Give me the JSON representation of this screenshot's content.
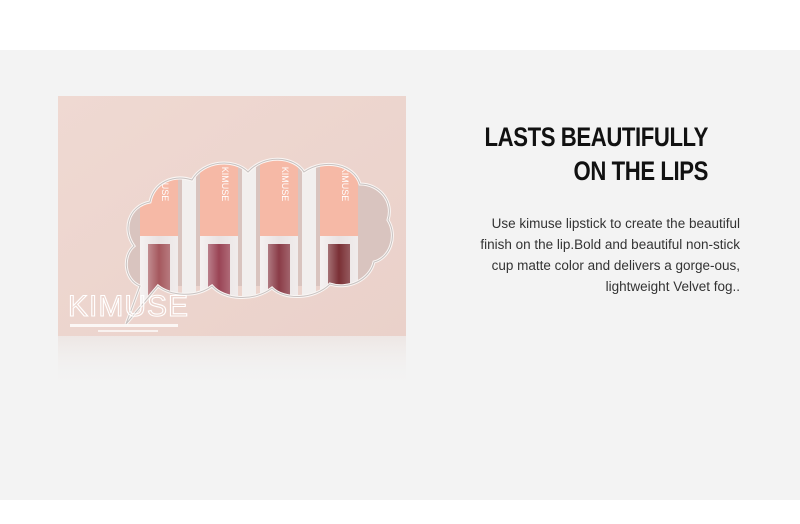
{
  "product": {
    "brand_logo": "KIMUSE",
    "tube_label": "KIMUSE",
    "colors": {
      "box": "#efd9d2",
      "cap": "#f6b9a6",
      "window_border": "#f8f4f2",
      "lipstick_shades": [
        "#a5585e",
        "#9a4455",
        "#8a3c47",
        "#7a3035"
      ]
    }
  },
  "headline": {
    "line1": "LASTS BEAUTIFULLY",
    "line2": "ON THE LIPS"
  },
  "description": {
    "line1": "Use kimuse lipstick  to create the beautiful",
    "line2": "finish on the lip.Bold and beautiful non-stick",
    "line3": "cup matte color and delivers a gorge-ous,",
    "line4": "lightweight Velvet fog.."
  }
}
